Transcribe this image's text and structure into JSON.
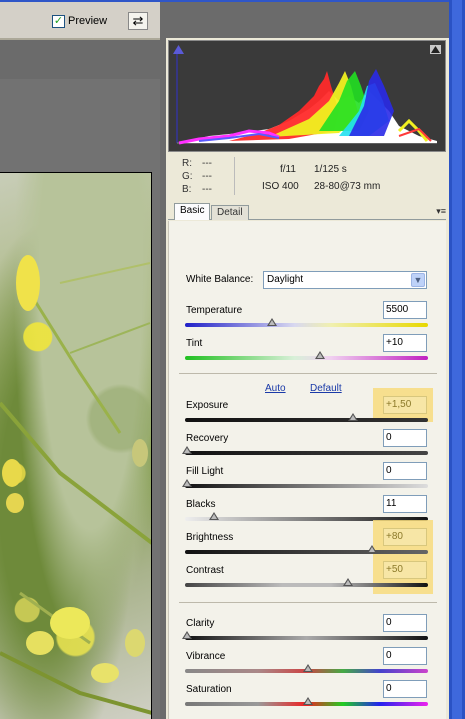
{
  "toolbar": {
    "preview_label": "Preview",
    "preview_checked": true,
    "swap_icon": "compare-views-icon"
  },
  "info": {
    "r_label": "R:",
    "r_value": "---",
    "g_label": "G:",
    "g_value": "---",
    "b_label": "B:",
    "b_value": "---",
    "aperture": "f/11",
    "shutter": "1/125 s",
    "iso": "ISO 400",
    "lens": "28-80@73 mm"
  },
  "tabs": [
    {
      "label": "Basic",
      "active": true
    },
    {
      "label": "Detail",
      "active": false
    }
  ],
  "tab_menu_icon": "panel-menu-icon",
  "basic": {
    "white_balance_label": "White Balance:",
    "white_balance_value": "Daylight",
    "temperature": {
      "label": "Temperature",
      "value": "5500"
    },
    "tint": {
      "label": "Tint",
      "value": "+10"
    },
    "auto_link": "Auto",
    "default_link": "Default",
    "exposure": {
      "label": "Exposure",
      "value": "+1,50"
    },
    "recovery": {
      "label": "Recovery",
      "value": "0"
    },
    "fill_light": {
      "label": "Fill Light",
      "value": "0"
    },
    "blacks": {
      "label": "Blacks",
      "value": "11"
    },
    "brightness": {
      "label": "Brightness",
      "value": "+80"
    },
    "contrast": {
      "label": "Contrast",
      "value": "+50"
    },
    "clarity": {
      "label": "Clarity",
      "value": "0"
    },
    "vibrance": {
      "label": "Vibrance",
      "value": "0"
    },
    "saturation": {
      "label": "Saturation",
      "value": "0"
    }
  },
  "highlight_color": "#f7dc7e"
}
